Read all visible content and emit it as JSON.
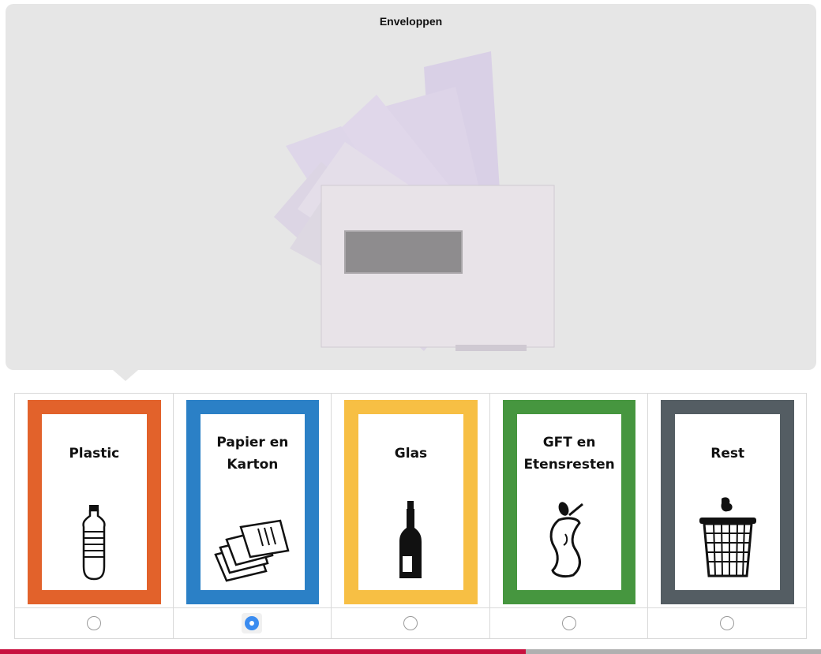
{
  "item": {
    "title": "Enveloppen",
    "image": "envelopes-stack"
  },
  "bins": [
    {
      "label": "Plastic",
      "color": "#e2622b",
      "icon": "plastic-bottle-icon",
      "selected": false
    },
    {
      "label": "Papier en\nKarton",
      "color": "#2b80c6",
      "icon": "paper-stack-icon",
      "selected": true
    },
    {
      "label": "Glas",
      "color": "#f7bf44",
      "icon": "glass-bottle-icon",
      "selected": false
    },
    {
      "label": "GFT en\nEtensresten",
      "color": "#46963f",
      "icon": "apple-core-icon",
      "selected": false
    },
    {
      "label": "Rest",
      "color": "#545d63",
      "icon": "trash-bin-icon",
      "selected": false
    }
  ],
  "progress": {
    "fraction": 0.64,
    "fill_color": "#c8103e",
    "track_color": "#b0b0b0"
  }
}
